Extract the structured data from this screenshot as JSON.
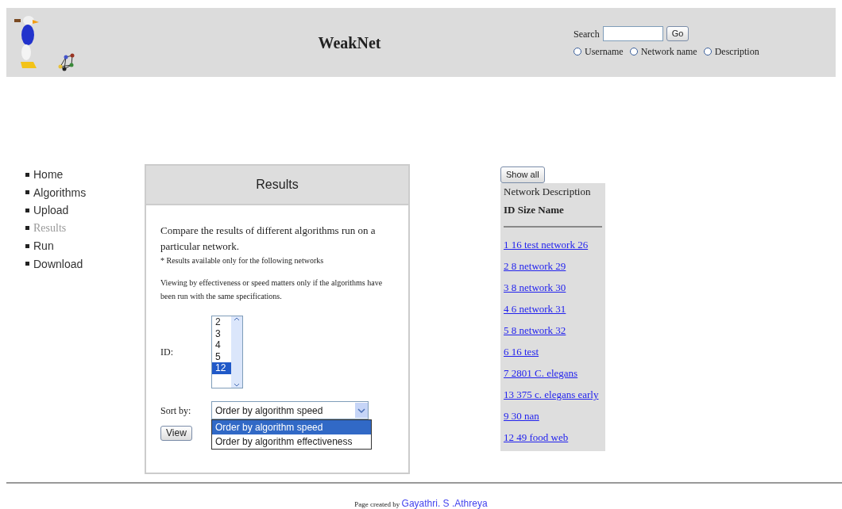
{
  "header": {
    "title": "WeakNet",
    "search": {
      "label": "Search",
      "button": "Go",
      "options": [
        {
          "label": "Username",
          "selected": false
        },
        {
          "label": "Network name",
          "selected": false
        },
        {
          "label": "Description",
          "selected": false
        }
      ]
    }
  },
  "nav": [
    {
      "label": "Home",
      "selected": false
    },
    {
      "label": "Algorithms",
      "selected": false
    },
    {
      "label": "Upload",
      "selected": false
    },
    {
      "label": "Results",
      "selected": true
    },
    {
      "label": "Run",
      "selected": false
    },
    {
      "label": "Download",
      "selected": false
    }
  ],
  "results": {
    "title": "Results",
    "intro": "Compare the results of different algorithms run on a particular network.",
    "note": "* Results available only for the following networks",
    "info": "Viewing by effectiveness or speed matters only if the algorithms have been run with the same specifications.",
    "id_label": "ID:",
    "id_list": [
      {
        "label": "2",
        "selected": false
      },
      {
        "label": "3",
        "selected": false
      },
      {
        "label": "4",
        "selected": false
      },
      {
        "label": "5",
        "selected": false
      },
      {
        "label": "12",
        "selected": true
      }
    ],
    "sort_label": "Sort by:",
    "sort_value": "Order by algorithm speed",
    "sort_options": [
      {
        "label": "Order by algorithm speed",
        "selected": true
      },
      {
        "label": "Order by algorithm effectiveness",
        "selected": false
      }
    ],
    "view_button": "View"
  },
  "networks": {
    "show_all": "Show all",
    "heading": "Network Description",
    "columns": "ID Size Name",
    "links": [
      "1 16 test network 26",
      "2 8 network 29",
      "3 8 network 30",
      "4 6 network 31",
      "5 8 network 32",
      "6 16 test",
      "7 2801 C. elegans",
      "13 375 c. elegans early",
      "9 30 nan",
      "12 49 food web"
    ]
  },
  "footer": {
    "prefix": "Page created by",
    "author": "Gayathri. S .Athreya"
  }
}
